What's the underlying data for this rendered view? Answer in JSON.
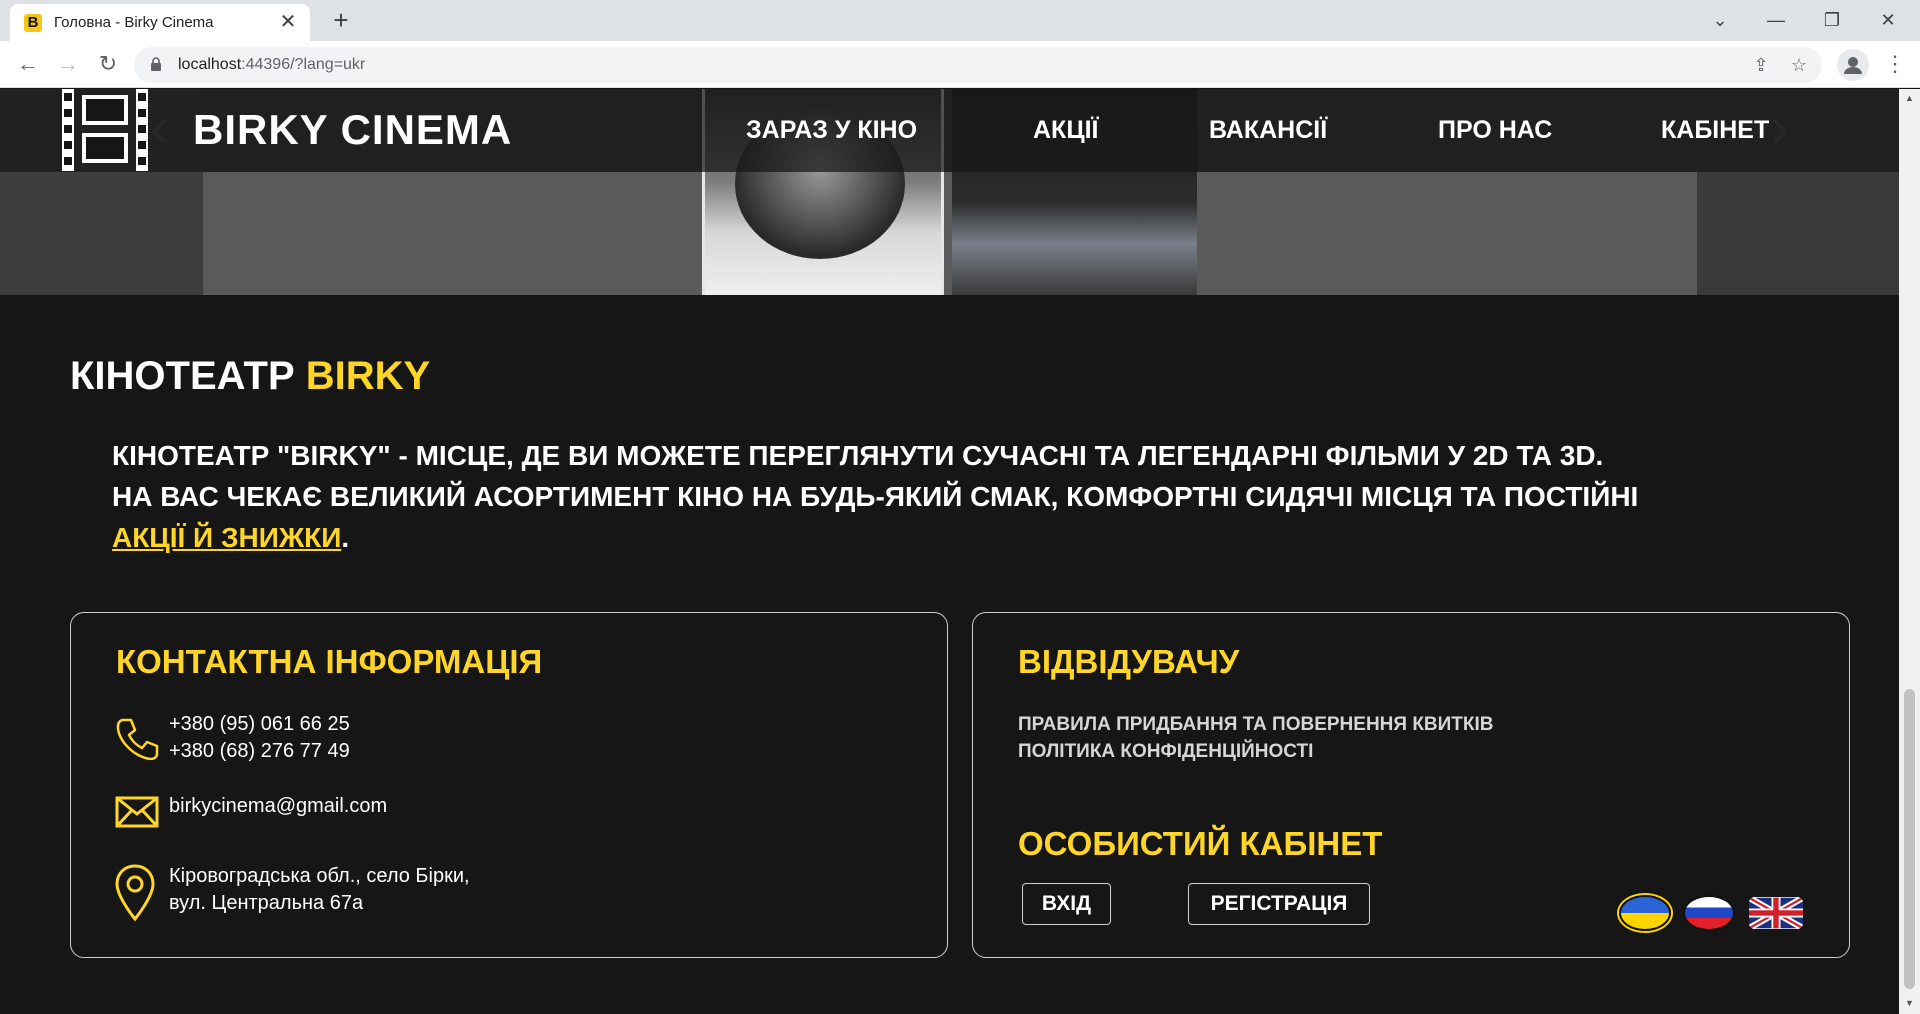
{
  "browser": {
    "tab_title": "Головна - Birky Cinema",
    "favicon_letter": "B",
    "url_host": "localhost",
    "url_rest": ":44396/?lang=ukr"
  },
  "site": {
    "logo_text": "BIRKY CINEMA",
    "nav": [
      {
        "label": "ЗАРАЗ У КІНО"
      },
      {
        "label": "АКЦІЇ"
      },
      {
        "label": "ВАКАНСІЇ"
      },
      {
        "label": "ПРО НАС"
      },
      {
        "label": "КАБІНЕТ"
      }
    ]
  },
  "about": {
    "title_prefix": "КІНОТЕАТР ",
    "title_accent": "BIRKY",
    "line1": "КІНОТЕАТР \"BIRKY\" - МІСЦЕ, ДЕ ВИ МОЖЕТЕ ПЕРЕГЛЯНУТИ СУЧАСНІ ТА ЛЕГЕНДАРНІ ФІЛЬМИ У 2D ТА 3D.",
    "line2": "НА ВАС ЧЕКАЄ ВЕЛИКИЙ АСОРТИМЕНТ КІНО НА БУДЬ-ЯКИЙ СМАК, КОМФОРТНІ СИДЯЧІ МІСЦЯ ТА ПОСТІЙНІ",
    "link": "АКЦІЇ Й ЗНИЖКИ",
    "end": "."
  },
  "contacts": {
    "title": "КОНТАКТНА ІНФОРМАЦІЯ",
    "phone1": "+380 (95) 061 66 25",
    "phone2": "+380 (68) 276 77 49",
    "email": "birkycinema@gmail.com",
    "address1": "Кіровоградська обл., село Бірки,",
    "address2": "вул. Центральна 67а"
  },
  "visitor": {
    "title": "ВІДВІДУВАЧУ",
    "rules": "ПРАВИЛА ПРИДБАННЯ ТА ПОВЕРНЕННЯ КВИТКІВ",
    "privacy": "ПОЛІТИКА КОНФІДЕНЦІЙНОСТІ",
    "cabinet_title": "ОСОБИСТИЙ КАБІНЕТ",
    "login": "ВХІД",
    "register": "РЕГІСТРАЦІЯ"
  },
  "colors": {
    "accent": "#ffd628",
    "background": "#161616"
  },
  "languages": [
    "ukr",
    "rus",
    "eng"
  ]
}
